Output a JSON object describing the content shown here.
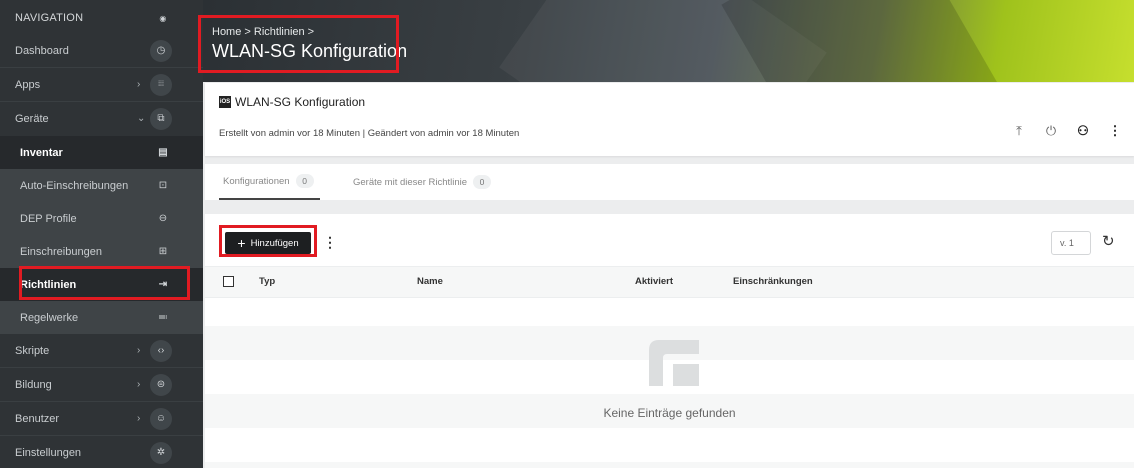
{
  "sidebar": {
    "header": "NAVIGATION",
    "items": [
      {
        "label": "Dashboard",
        "icon": "dashboard-icon",
        "glyph": "◷",
        "chevron": ""
      },
      {
        "label": "Apps",
        "icon": "apps-grid-icon",
        "glyph": "⁞⁞⁞",
        "chevron": "›"
      },
      {
        "label": "Geräte",
        "icon": "devices-icon",
        "glyph": "⧉",
        "chevron": "⌄"
      },
      {
        "label": "Inventar",
        "icon": "inventory-icon",
        "glyph": "▤",
        "chevron": ""
      },
      {
        "label": "Auto-Einschreibungen",
        "icon": "auto-enroll-icon",
        "glyph": "⊡",
        "chevron": ""
      },
      {
        "label": "DEP Profile",
        "icon": "dep-profile-icon",
        "glyph": "⊖",
        "chevron": ""
      },
      {
        "label": "Einschreibungen",
        "icon": "enrollments-icon",
        "glyph": "⊞",
        "chevron": ""
      },
      {
        "label": "Richtlinien",
        "icon": "policies-icon",
        "glyph": "⇥",
        "chevron": ""
      },
      {
        "label": "Regelwerke",
        "icon": "rulesets-icon",
        "glyph": "≕",
        "chevron": ""
      },
      {
        "label": "Skripte",
        "icon": "scripts-icon",
        "glyph": "‹›",
        "chevron": "›"
      },
      {
        "label": "Bildung",
        "icon": "education-icon",
        "glyph": "⊜",
        "chevron": "›"
      },
      {
        "label": "Benutzer",
        "icon": "users-icon",
        "glyph": "☺",
        "chevron": "›"
      },
      {
        "label": "Einstellungen",
        "icon": "settings-gear-icon",
        "glyph": "✲",
        "chevron": ""
      }
    ]
  },
  "banner": {
    "breadcrumb": "Home > Richtlinien >",
    "title": "WLAN-SG Konfiguration"
  },
  "card": {
    "badge": "iOS",
    "title": "WLAN-SG Konfiguration",
    "meta": "Erstellt von admin vor 18 Minuten  |  Geändert von admin vor 18 Minuten"
  },
  "tabs": [
    {
      "label": "Konfigurationen",
      "count": "0"
    },
    {
      "label": "Geräte mit dieser Richtlinie",
      "count": "0"
    }
  ],
  "toolbar": {
    "add_label": "Hinzufügen",
    "version": "v. 1"
  },
  "table": {
    "columns": [
      "Typ",
      "Name",
      "Aktiviert",
      "Einschränkungen"
    ],
    "empty_text": "Keine Einträge gefunden"
  },
  "colors": {
    "highlight": "#e11b22",
    "sidebar": "#2f3336",
    "accent": "#c6df2e"
  }
}
